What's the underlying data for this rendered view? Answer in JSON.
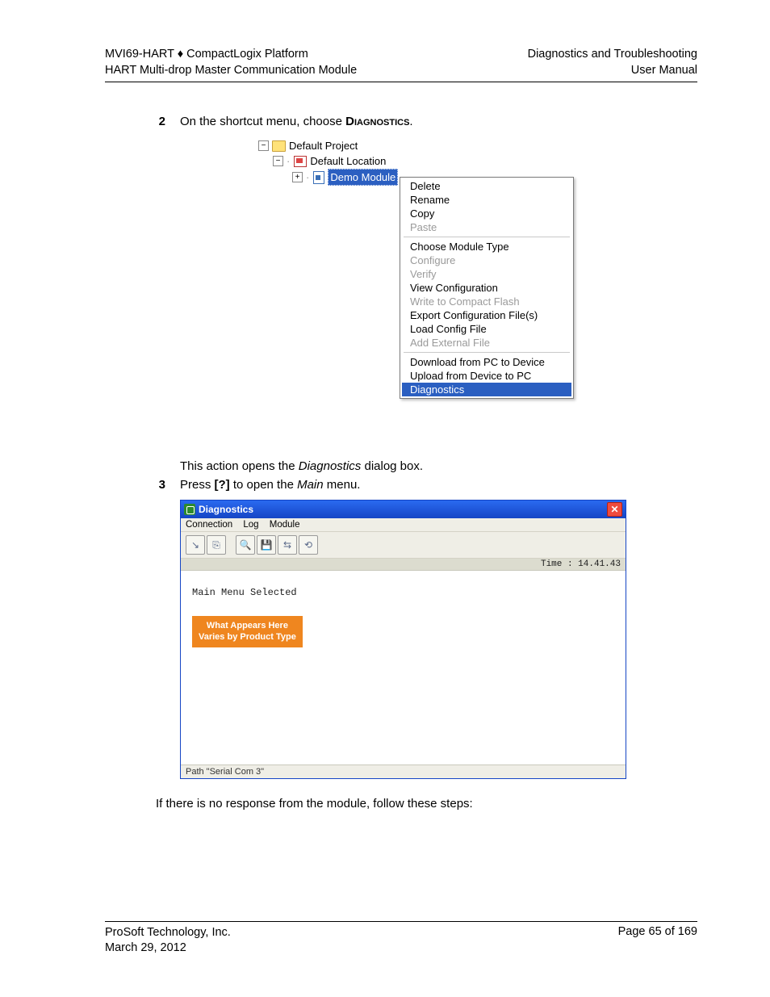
{
  "header": {
    "left_line1": "MVI69-HART ♦ CompactLogix Platform",
    "left_line2": "HART Multi-drop Master Communication Module",
    "right_line1": "Diagnostics and Troubleshooting",
    "right_line2": "User Manual"
  },
  "steps": {
    "s2_num": "2",
    "s2_pre": "On the shortcut menu, choose ",
    "s2_emph": "Diagnostics",
    "s2_post": ".",
    "s3_num": "3",
    "s3_pre": "Press ",
    "s3_key": "[?]",
    "s3_mid": " to open the ",
    "s3_emph": "Main",
    "s3_post": " menu."
  },
  "tree": {
    "project": "Default Project",
    "location": "Default Location",
    "module": "Demo Module"
  },
  "ctx": {
    "delete": "Delete",
    "rename": "Rename",
    "copy": "Copy",
    "paste": "Paste",
    "choose_type": "Choose Module Type",
    "configure": "Configure",
    "verify": "Verify",
    "view_cfg": "View Configuration",
    "write_cf": "Write to Compact Flash",
    "export_cfg": "Export Configuration File(s)",
    "load_cfg": "Load Config File",
    "add_ext": "Add External File",
    "dl_pc_dev": "Download from PC to Device",
    "ul_dev_pc": "Upload from Device to PC",
    "diagnostics": "Diagnostics"
  },
  "para1_pre": "This action opens the ",
  "para1_emph": "Diagnostics",
  "para1_post": " dialog box.",
  "diag": {
    "title": "Diagnostics",
    "menu_connection": "Connection",
    "menu_log": "Log",
    "menu_module": "Module",
    "time_label": "Time : 14.41.43",
    "term_line": "Main Menu Selected",
    "orange_l1": "What Appears Here",
    "orange_l2": "Varies by Product Type",
    "status": "Path \"Serial Com 3\""
  },
  "para2": "If there is no response from the module, follow these steps:",
  "footer": {
    "company": "ProSoft Technology, Inc.",
    "date": "March 29, 2012",
    "page": "Page 65 of 169"
  }
}
